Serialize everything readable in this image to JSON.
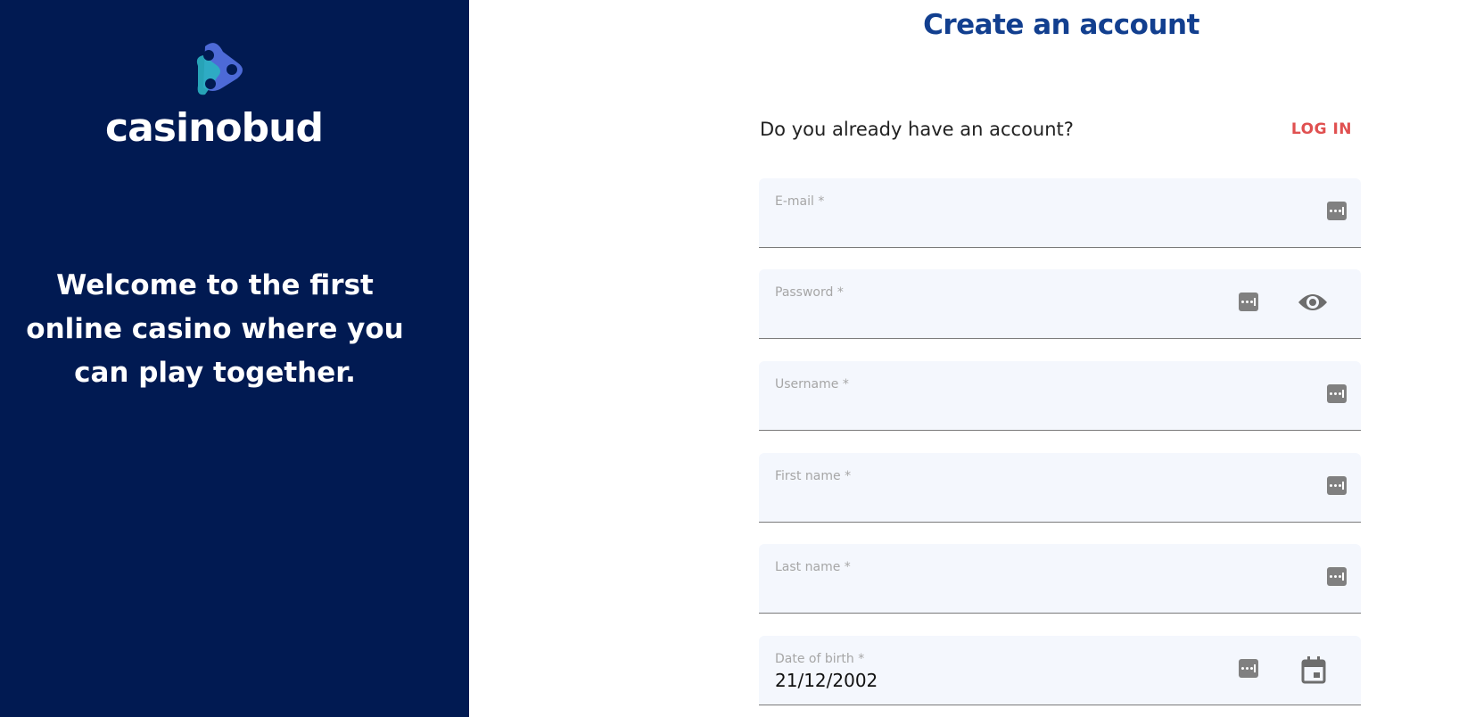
{
  "brand": {
    "name": "casinobud",
    "welcome": "Welcome to the first online casino where you can play together.",
    "colors": {
      "panel": "#011a52",
      "logo_blue": "#5a79ee",
      "logo_teal": "#2bb3c2"
    }
  },
  "form": {
    "title": "Create an account",
    "have_account": "Do you already have an account?",
    "login_label": "LOG IN",
    "fields": [
      {
        "label": "E-mail *",
        "value": "",
        "icons": [
          "password-manager-icon"
        ]
      },
      {
        "label": "Password *",
        "value": "",
        "icons": [
          "password-manager-icon",
          "eye-icon"
        ]
      },
      {
        "label": "Username *",
        "value": "",
        "icons": [
          "password-manager-icon"
        ]
      },
      {
        "label": "First name *",
        "value": "",
        "icons": [
          "password-manager-icon"
        ]
      },
      {
        "label": "Last name *",
        "value": "",
        "icons": [
          "password-manager-icon"
        ]
      },
      {
        "label": "Date of birth *",
        "value": "21/12/2002",
        "icons": [
          "password-manager-icon",
          "calendar-icon"
        ]
      }
    ],
    "colors": {
      "title": "#123f8f",
      "login": "#e05050",
      "field_bg": "#f4f7fd"
    }
  }
}
